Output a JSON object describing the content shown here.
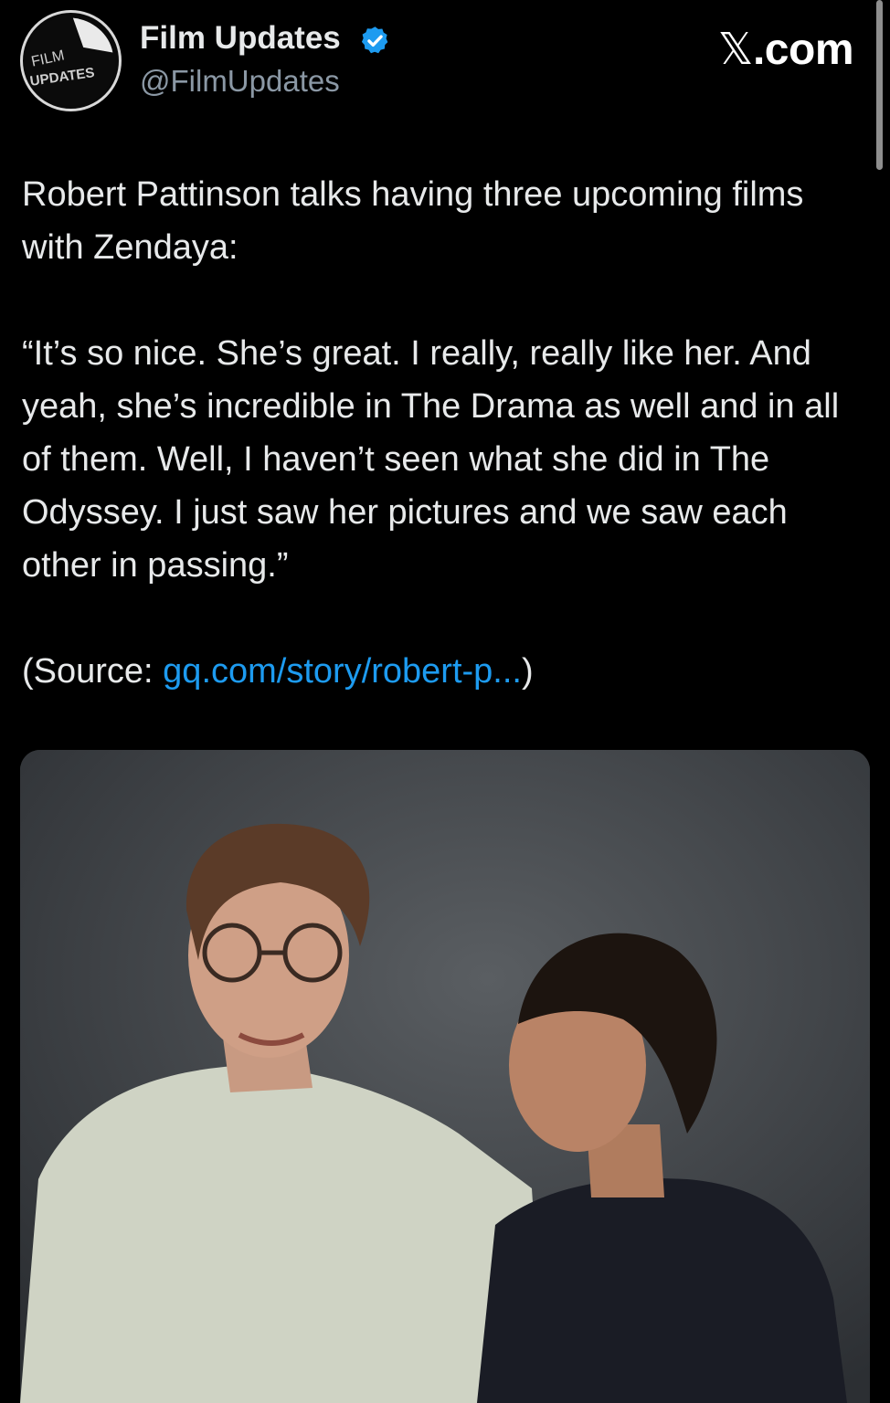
{
  "brand": {
    "site_label": ".com",
    "logo_icon": "x-logo-icon"
  },
  "account": {
    "avatar_text_top": "FILM",
    "avatar_text_bottom": "UPDATES",
    "display_name": "Film Updates",
    "handle": "@FilmUpdates",
    "verified_icon": "verified-badge-icon",
    "verified_color": "#1d9bf0"
  },
  "post": {
    "headline": "Robert Pattinson talks having three upcoming films with Zendaya:",
    "quote": "“It’s so nice. She’s great. I really, really like her. And yeah, she’s incredible in The Drama as well and in all of them. Well, I haven’t seen what she did in The Odyssey. I just saw her pictures and we saw each other in passing.”",
    "source_prefix": "(Source: ",
    "source_link": "gq.com/story/robert-p...",
    "source_suffix": ")"
  },
  "colors": {
    "background": "#000000",
    "text": "#e7e9ea",
    "secondary": "#8b98a5",
    "link": "#1d9bf0"
  }
}
